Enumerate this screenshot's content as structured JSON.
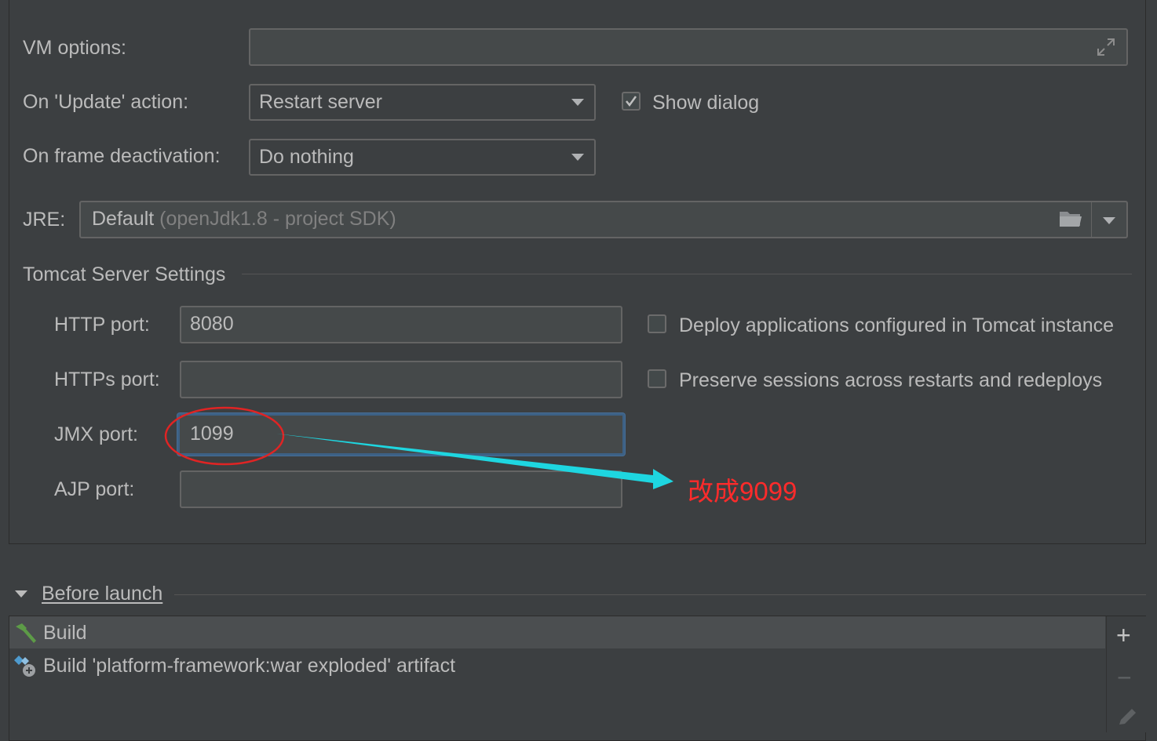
{
  "vm_options": {
    "label": "VM options:",
    "value": ""
  },
  "on_update": {
    "label": "On 'Update' action:",
    "selected": "Restart server",
    "show_dialog_label": "Show dialog",
    "show_dialog_checked": true
  },
  "on_frame": {
    "label": "On frame deactivation:",
    "selected": "Do nothing"
  },
  "jre": {
    "label": "JRE:",
    "value": "Default",
    "hint": "(openJdk1.8 - project SDK)"
  },
  "tomcat": {
    "section_title": "Tomcat Server Settings",
    "http_port": {
      "label": "HTTP port:",
      "value": "8080"
    },
    "https_port": {
      "label": "HTTPs port:",
      "value": ""
    },
    "jmx_port": {
      "label": "JMX port:",
      "value": "1099"
    },
    "ajp_port": {
      "label": "AJP port:",
      "value": ""
    },
    "deploy_label": "Deploy applications configured in Tomcat instance",
    "deploy_checked": false,
    "preserve_label": "Preserve sessions across restarts and redeploys",
    "preserve_checked": false
  },
  "annotation": {
    "text": "改成9099",
    "color": "#ff2b2b",
    "arrow_color": "#1ed6e0"
  },
  "before_launch": {
    "title": "Before launch",
    "items": [
      {
        "label": "Build",
        "icon": "hammer-icon"
      },
      {
        "label": "Build 'platform-framework:war exploded' artifact",
        "icon": "artifact-icon"
      }
    ],
    "add_label": "+",
    "remove_label": "−"
  }
}
